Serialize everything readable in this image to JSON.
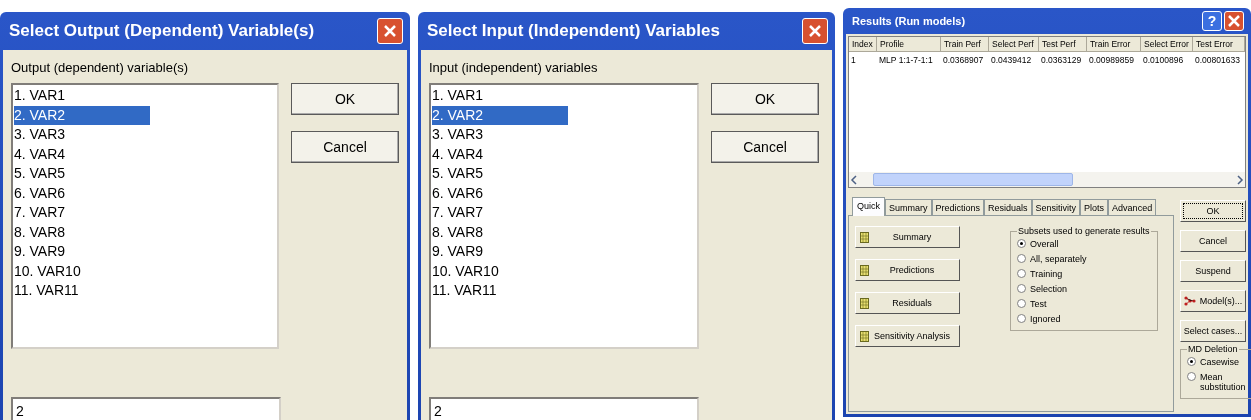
{
  "select_dialogs": [
    {
      "title": "Select Output (Dependent) Variable(s)",
      "label": "Output (dependent) variable(s)",
      "items": [
        {
          "text": "1. VAR1",
          "selected": false
        },
        {
          "text": "2. VAR2",
          "selected": true
        },
        {
          "text": "3. VAR3",
          "selected": false
        },
        {
          "text": "4. VAR4",
          "selected": false
        },
        {
          "text": "5. VAR5",
          "selected": false
        },
        {
          "text": "6. VAR6",
          "selected": false
        },
        {
          "text": "7. VAR7",
          "selected": false
        },
        {
          "text": "8. VAR8",
          "selected": false
        },
        {
          "text": "9. VAR9",
          "selected": false
        },
        {
          "text": "10. VAR10",
          "selected": false
        },
        {
          "text": "11. VAR11",
          "selected": false
        }
      ],
      "buttons": [
        "OK",
        "Cancel"
      ],
      "value": "2"
    },
    {
      "title": "Select Input (Independent) Variables",
      "label": "Input (independent) variables",
      "items": [
        {
          "text": "1. VAR1",
          "selected": false
        },
        {
          "text": "2. VAR2",
          "selected": true
        },
        {
          "text": "3. VAR3",
          "selected": false
        },
        {
          "text": "4. VAR4",
          "selected": false
        },
        {
          "text": "5. VAR5",
          "selected": false
        },
        {
          "text": "6. VAR6",
          "selected": false
        },
        {
          "text": "7. VAR7",
          "selected": false
        },
        {
          "text": "8. VAR8",
          "selected": false
        },
        {
          "text": "9. VAR9",
          "selected": false
        },
        {
          "text": "10. VAR10",
          "selected": false
        },
        {
          "text": "11. VAR11",
          "selected": false
        }
      ],
      "buttons": [
        "OK",
        "Cancel"
      ],
      "value": "2"
    }
  ],
  "results_dialog": {
    "title": "Results (Run models)",
    "help": "?",
    "table": {
      "columns": [
        "Index",
        "Profile",
        "Train Perf",
        "Select Perf",
        "Test Perf",
        "Train Error",
        "Select Error",
        "Test Error"
      ],
      "rows": [
        [
          "1",
          "MLP 1:1-7-1:1",
          "0.0368907",
          "0.0439412",
          "0.0363129",
          "0.00989859",
          "0.0100896",
          "0.00801633"
        ]
      ]
    },
    "tabs": [
      {
        "label": "Quick",
        "selected": true
      },
      {
        "label": "Summary",
        "selected": false
      },
      {
        "label": "Predictions",
        "selected": false
      },
      {
        "label": "Residuals",
        "selected": false
      },
      {
        "label": "Sensitivity",
        "selected": false
      },
      {
        "label": "Plots",
        "selected": false
      },
      {
        "label": "Advanced",
        "selected": false
      }
    ],
    "quick_buttons": [
      "Summary",
      "Predictions",
      "Residuals",
      "Sensitivity Analysis"
    ],
    "subsets": {
      "title": "Subsets used to generate results",
      "options": [
        {
          "label": "Overall",
          "selected": true
        },
        {
          "label": "All, separately",
          "selected": false
        },
        {
          "label": "Training",
          "selected": false
        },
        {
          "label": "Selection",
          "selected": false
        },
        {
          "label": "Test",
          "selected": false
        },
        {
          "label": "Ignored",
          "selected": false
        }
      ]
    },
    "side_buttons": [
      {
        "label": "OK",
        "kind": "default"
      },
      {
        "label": "Cancel",
        "kind": "plain"
      },
      {
        "label": "Suspend",
        "kind": "plain"
      },
      {
        "label": "Model(s)...",
        "kind": "icon"
      },
      {
        "label": "Select cases...",
        "kind": "plain"
      }
    ],
    "md_deletion": {
      "title": "MD Deletion",
      "options": [
        {
          "label": "Casewise",
          "selected": true
        },
        {
          "label": "Mean substitution",
          "selected": false
        }
      ]
    }
  }
}
